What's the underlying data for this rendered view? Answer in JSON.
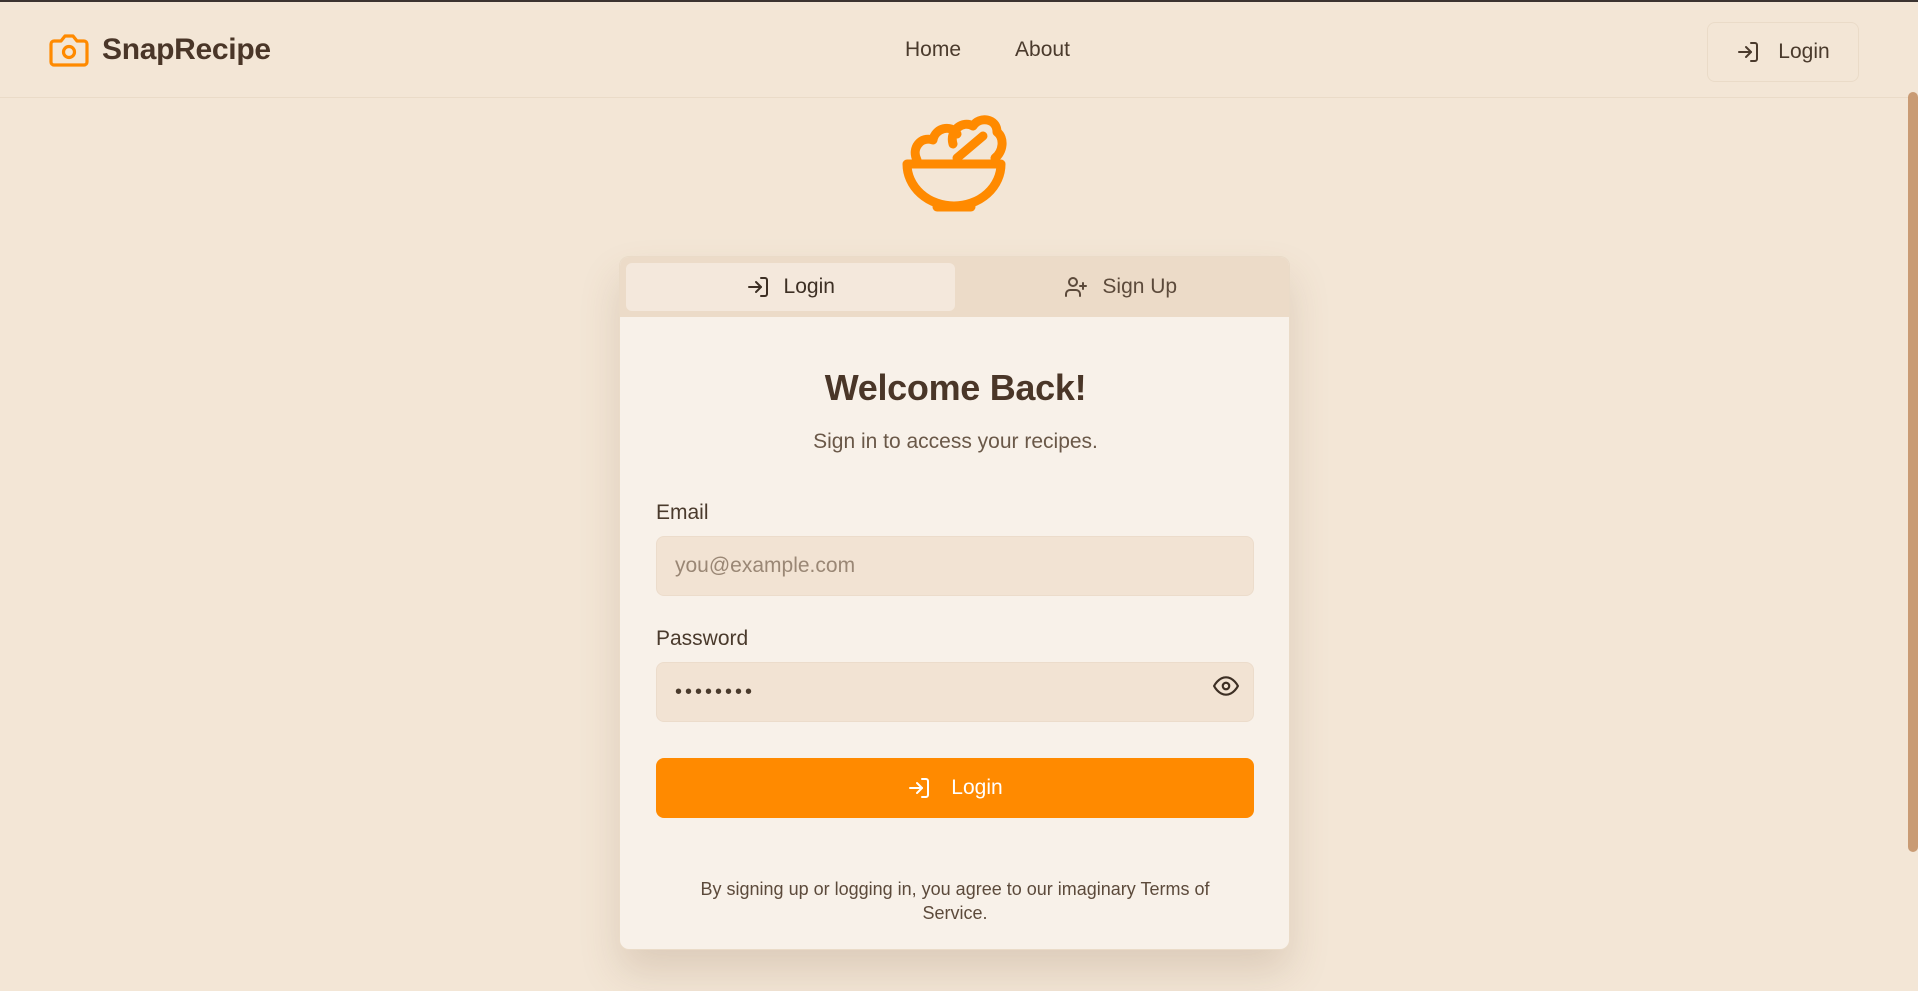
{
  "header": {
    "brand": "SnapRecipe",
    "nav": [
      {
        "label": "Home"
      },
      {
        "label": "About"
      }
    ],
    "login_label": "Login"
  },
  "auth": {
    "tabs": [
      {
        "label": "Login",
        "icon": "log-in-icon",
        "active": true
      },
      {
        "label": "Sign Up",
        "icon": "user-plus-icon",
        "active": false
      }
    ],
    "title": "Welcome Back!",
    "subtitle": "Sign in to access your recipes.",
    "email": {
      "label": "Email",
      "placeholder": "you@example.com",
      "value": ""
    },
    "password": {
      "label": "Password",
      "value": "••••••••"
    },
    "submit_label": "Login",
    "terms": "By signing up or logging in, you agree to our imaginary Terms of Service."
  },
  "colors": {
    "accent": "#ff8a00",
    "background": "#f3e6d6",
    "card": "#f8f1e9",
    "text": "#4a3628"
  }
}
